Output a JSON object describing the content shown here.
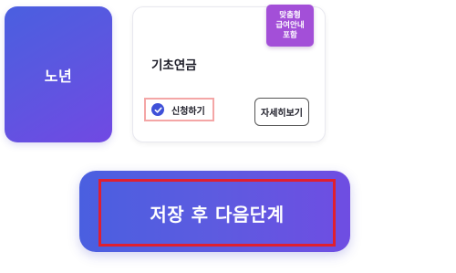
{
  "category": {
    "label": "노년"
  },
  "benefit_card": {
    "title": "기초연금",
    "badge_lines": [
      "맞춤형",
      "급여안내",
      "포함"
    ],
    "apply_label": "신청하기",
    "apply_checked": true,
    "detail_label": "자세히보기"
  },
  "footer": {
    "save_next_label": "저장 후 다음단계"
  },
  "colors": {
    "primary": "#4a5fe0",
    "primary_end": "#7149e3",
    "badge": "#a34fd8",
    "apply_outline": "#f4a6a6",
    "highlight": "#e01f2f"
  },
  "icons": {
    "apply": "check-circle-icon"
  }
}
